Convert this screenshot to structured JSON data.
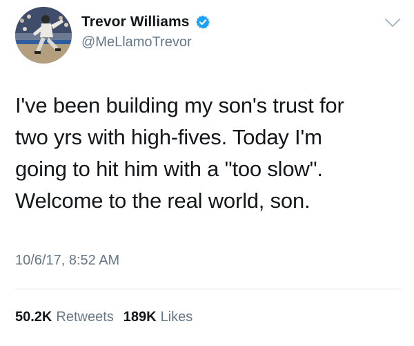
{
  "user": {
    "display_name": "Trevor Williams",
    "handle": "@MeLlamoTrevor",
    "verified": true,
    "avatar_icon": "baseball-pitcher-avatar"
  },
  "tweet": {
    "text_lines": [
      "I've been building my son's trust for",
      "two yrs with high-fives. Today I'm",
      "going to hit him with a \"too slow\".",
      "Welcome to the real world, son."
    ],
    "timestamp": "10/6/17, 8:52 AM"
  },
  "stats": {
    "retweets_count": "50.2K",
    "retweets_label": "Retweets",
    "likes_count": "189K",
    "likes_label": "Likes"
  },
  "colors": {
    "text_primary": "#14171a",
    "text_secondary": "#657786",
    "verified_blue": "#1da1f2",
    "divider": "#e1e8ed"
  }
}
